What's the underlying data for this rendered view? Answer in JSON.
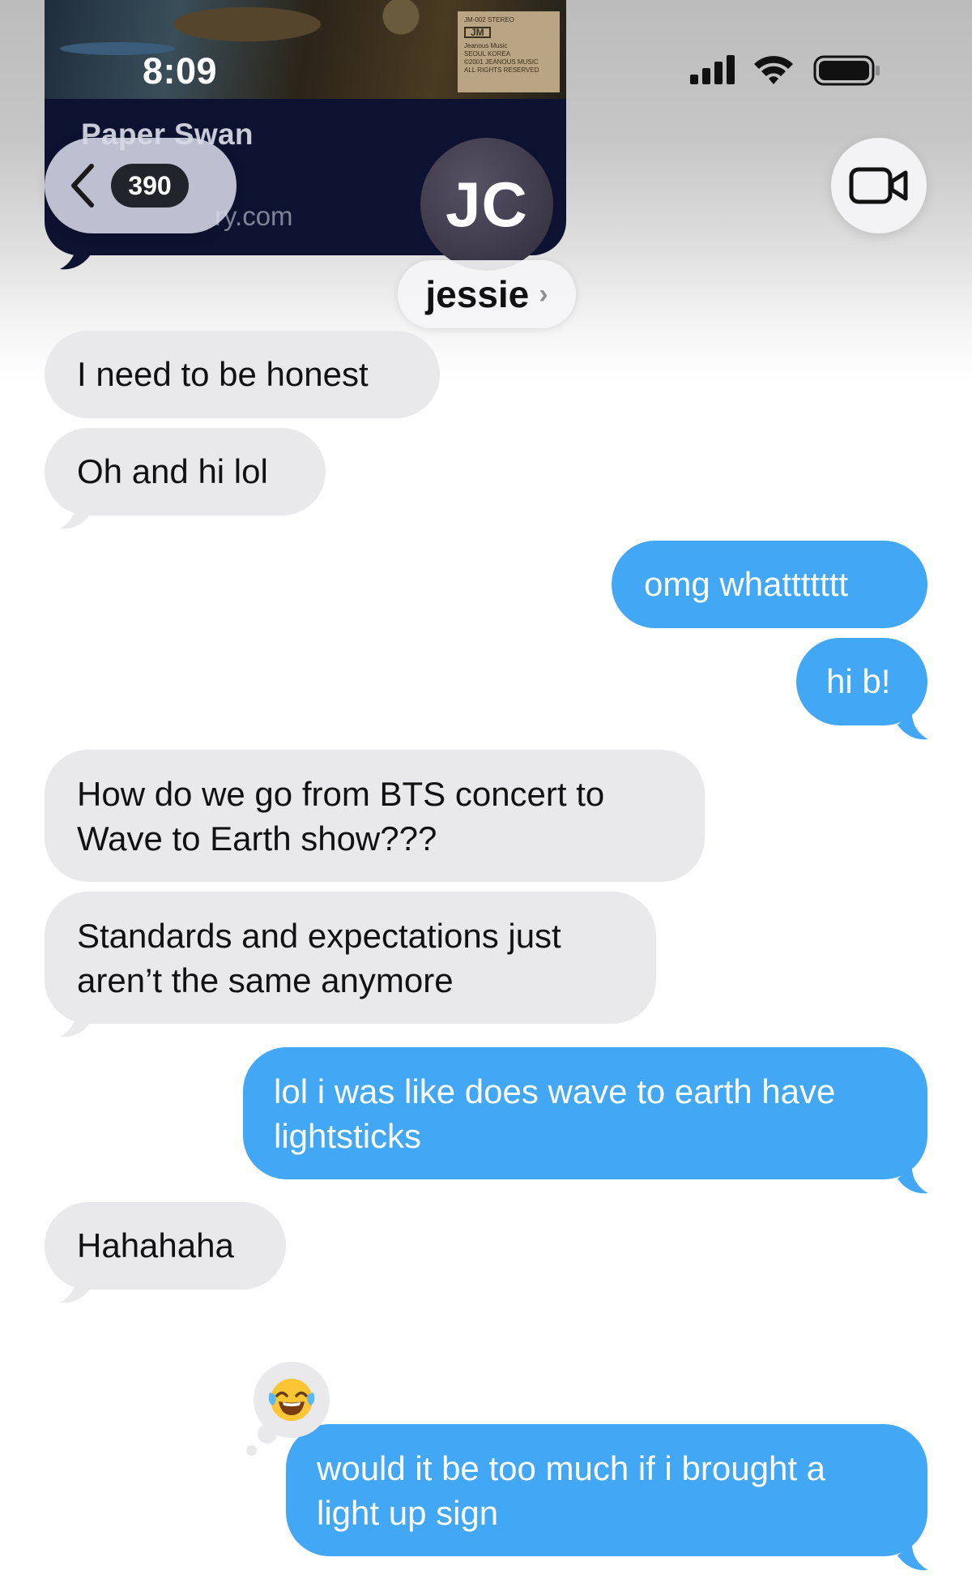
{
  "status_bar": {
    "time": "8:09"
  },
  "shared_link": {
    "album_label_lines": [
      "JM-002  STEREO",
      "JM",
      "Jeanous Music",
      "SEOUL KOREA",
      "©2001 JEANOUS MUSIC",
      "ALL RIGHTS RESERVED"
    ],
    "title": "Paper Swan",
    "url_suffix": "ry.com"
  },
  "nav": {
    "back_count": "390",
    "avatar_initials": "JC",
    "contact_name": "jessie",
    "contact_chevron": "›"
  },
  "messages": [
    {
      "from": "them",
      "lines": [
        "I need to be honest"
      ]
    },
    {
      "from": "them",
      "lines": [
        "Oh and hi lol"
      ]
    },
    {
      "from": "me",
      "lines": [
        "omg whattttttt"
      ]
    },
    {
      "from": "me",
      "lines": [
        "hi b!"
      ]
    },
    {
      "from": "them",
      "lines": [
        "How do we go from BTS concert to",
        "Wave to Earth show???"
      ]
    },
    {
      "from": "them",
      "lines": [
        "Standards and expectations just",
        "aren’t the same anymore"
      ]
    },
    {
      "from": "me",
      "lines": [
        "lol i was like does wave to earth have",
        "lightsticks"
      ]
    },
    {
      "from": "them",
      "lines": [
        "Hahahaha"
      ]
    },
    {
      "from": "me",
      "lines": [
        "would it be too much if i brought a",
        "light up sign"
      ],
      "reaction": "😂"
    }
  ],
  "colors": {
    "incoming_bubble": "#e9e9eb",
    "outgoing_bubble": "#42a7f5",
    "avatar": "#3b3747",
    "link_card": "#0d1230"
  },
  "icons": [
    "signal-bars-icon",
    "wifi-icon",
    "battery-icon",
    "chevron-left-icon",
    "video-camera-icon"
  ]
}
